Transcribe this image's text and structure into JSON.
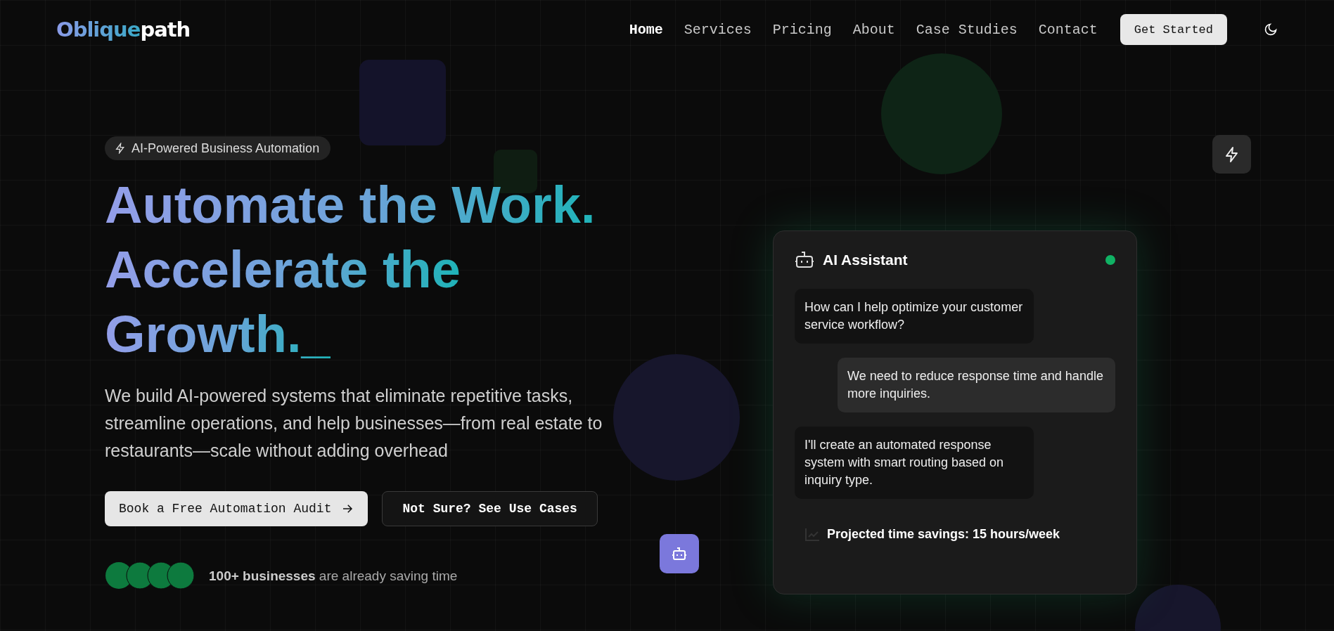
{
  "nav": {
    "logo_parts": [
      "Oblique",
      "path"
    ],
    "links": [
      {
        "label": "Home",
        "selected": true
      },
      {
        "label": "Services",
        "selected": false
      },
      {
        "label": "Pricing",
        "selected": false
      },
      {
        "label": "About",
        "selected": false
      },
      {
        "label": "Case Studies",
        "selected": false
      },
      {
        "label": "Contact",
        "selected": false
      }
    ],
    "cta": "Get Started"
  },
  "hero": {
    "badge": "AI-Powered Business Automation",
    "headline_lines": [
      "Automate the Work.",
      "Accelerate the",
      "Growth._"
    ],
    "description": "We build AI-powered systems that eliminate repetitive tasks, streamline operations, and help businesses—from real estate to restaurants—scale without adding overhead",
    "buttons": [
      {
        "label": "Book a Free Automation Audit",
        "kind": "primary"
      },
      {
        "label": "Not Sure? See Use Cases",
        "kind": "outline"
      }
    ],
    "social_proof": "**100+ businesses** are already saving time"
  },
  "assistant": {
    "title": "AI Assistant",
    "online": true,
    "messages": [
      {
        "kind": "assistant",
        "text": "How can I help optimize your customer service workflow?"
      },
      {
        "kind": "user",
        "text": "We need to reduce response time and handle more inquiries."
      },
      {
        "kind": "assistant",
        "text": "I'll create an automated response system with smart routing based on inquiry type."
      }
    ],
    "footer": "Projected time savings: 15 hours/week"
  }
}
